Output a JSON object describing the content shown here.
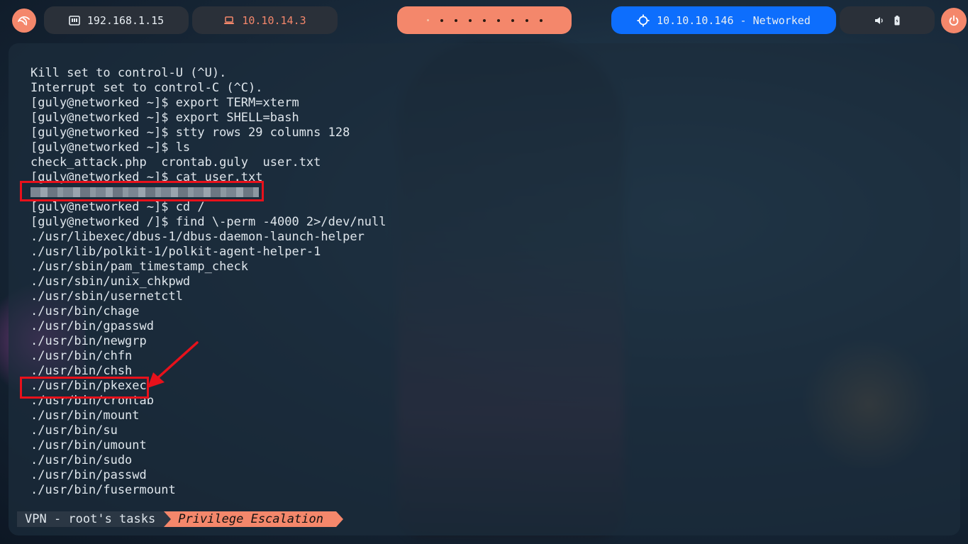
{
  "topbar": {
    "menu_icon": "kali-dragon-icon",
    "local_ip": "192.168.1.15",
    "vpn_ip": "10.10.14.3",
    "target": "10.10.10.146 - Networked",
    "power_icon": "power-icon",
    "accent": "#f4876b",
    "target_color": "#0d6efd"
  },
  "terminal": {
    "lines": [
      "Kill set to control-U (^U).",
      "Interrupt set to control-C (^C).",
      "[guly@networked ~]$ export TERM=xterm",
      "[guly@networked ~]$ export SHELL=bash",
      "[guly@networked ~]$ stty rows 29 columns 128",
      "[guly@networked ~]$ ls",
      "check_attack.php  crontab.guly  user.txt",
      "[guly@networked ~]$ cat user.txt",
      "",
      "[guly@networked ~]$ cd /",
      "[guly@networked /]$ find \\-perm -4000 2>/dev/null",
      "./usr/libexec/dbus-1/dbus-daemon-launch-helper",
      "./usr/lib/polkit-1/polkit-agent-helper-1",
      "./usr/sbin/pam_timestamp_check",
      "./usr/sbin/unix_chkpwd",
      "./usr/sbin/usernetctl",
      "./usr/bin/chage",
      "./usr/bin/gpasswd",
      "./usr/bin/newgrp",
      "./usr/bin/chfn",
      "./usr/bin/chsh",
      "./usr/bin/pkexec",
      "./usr/bin/crontab",
      "./usr/bin/mount",
      "./usr/bin/su",
      "./usr/bin/umount",
      "./usr/bin/sudo",
      "./usr/bin/passwd",
      "./usr/bin/fusermount"
    ],
    "highlight_color": "#e8111b"
  },
  "statusbar": {
    "session": "VPN - root's tasks",
    "window": "Privilege Escalation"
  }
}
